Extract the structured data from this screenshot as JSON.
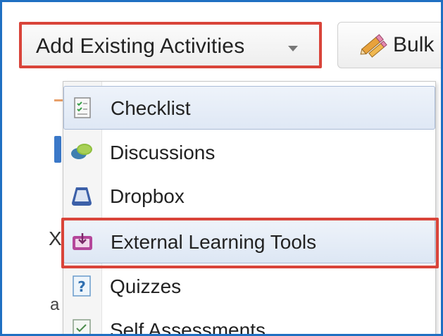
{
  "toolbar": {
    "add_existing_label": "Add Existing Activities",
    "bulk_label": "Bulk"
  },
  "menu": {
    "items": [
      {
        "label": "Checklist",
        "icon": "checklist-icon"
      },
      {
        "label": "Discussions",
        "icon": "discussions-icon"
      },
      {
        "label": "Dropbox",
        "icon": "dropbox-icon"
      },
      {
        "label": "External Learning Tools",
        "icon": "external-learning-tools-icon"
      },
      {
        "label": "Quizzes",
        "icon": "quizzes-icon"
      },
      {
        "label": "Self Assessments",
        "icon": "self-assessments-icon"
      }
    ]
  },
  "background": {
    "fragment_x": "X",
    "fragment_a": "a"
  },
  "colors": {
    "highlight": "#d9443a",
    "frame": "#1f6fc2",
    "hover": "#dfe8f5"
  }
}
